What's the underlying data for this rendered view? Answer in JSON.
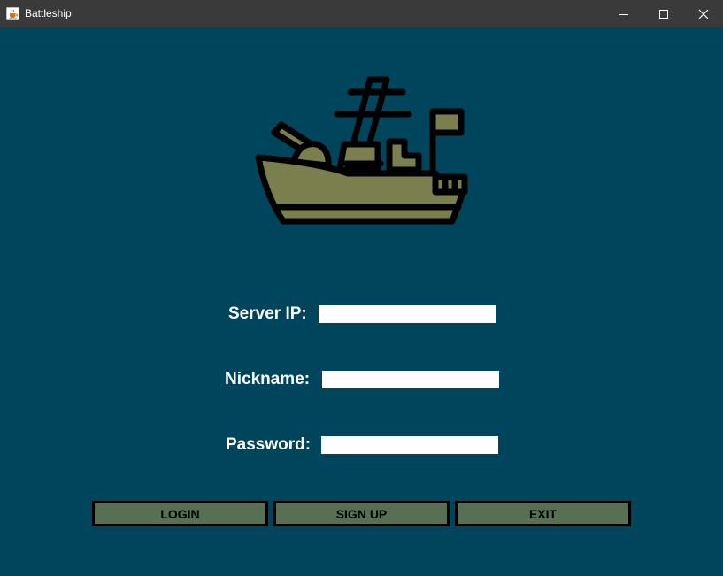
{
  "window": {
    "title": "Battleship",
    "icon": "java-cup-icon",
    "controls": [
      "minimize-icon",
      "maximize-icon",
      "close-icon"
    ]
  },
  "logo": {
    "icon": "battleship-icon"
  },
  "form": {
    "server_ip": {
      "label": "Server IP:",
      "value": ""
    },
    "nickname": {
      "label": "Nickname:",
      "value": ""
    },
    "password": {
      "label": "Password:",
      "value": ""
    }
  },
  "buttons": {
    "login": "LOGIN",
    "sign_up": "SIGN UP",
    "exit": "EXIT"
  },
  "colors": {
    "background": "#00455c",
    "titlebar": "#3a3a3a",
    "button_fill": "#576f53",
    "ship_fill": "#7b7f4e",
    "outline": "#000000"
  }
}
